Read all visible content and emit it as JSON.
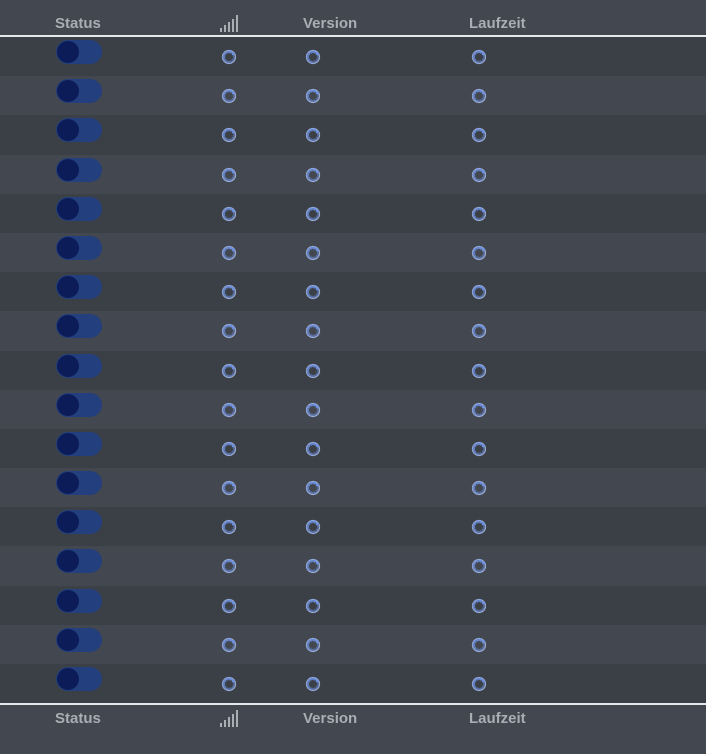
{
  "columns": {
    "status": "Status",
    "signal_icon": "signal-strength-icon",
    "version": "Version",
    "runtime": "Laufzeit"
  },
  "colors": {
    "background": "#43474f",
    "row_alt": "#3b3f46",
    "header_text": "#a9adb4",
    "toggle_track": "#233f7d",
    "toggle_knob": "#0c1c58",
    "spinner": "#5b7fd6"
  },
  "rows": [
    {
      "status_on": false,
      "signal": "loading",
      "version": "loading",
      "runtime": "loading"
    },
    {
      "status_on": false,
      "signal": "loading",
      "version": "loading",
      "runtime": "loading"
    },
    {
      "status_on": false,
      "signal": "loading",
      "version": "loading",
      "runtime": "loading"
    },
    {
      "status_on": false,
      "signal": "loading",
      "version": "loading",
      "runtime": "loading"
    },
    {
      "status_on": false,
      "signal": "loading",
      "version": "loading",
      "runtime": "loading"
    },
    {
      "status_on": false,
      "signal": "loading",
      "version": "loading",
      "runtime": "loading"
    },
    {
      "status_on": false,
      "signal": "loading",
      "version": "loading",
      "runtime": "loading"
    },
    {
      "status_on": false,
      "signal": "loading",
      "version": "loading",
      "runtime": "loading"
    },
    {
      "status_on": false,
      "signal": "loading",
      "version": "loading",
      "runtime": "loading"
    },
    {
      "status_on": false,
      "signal": "loading",
      "version": "loading",
      "runtime": "loading"
    },
    {
      "status_on": false,
      "signal": "loading",
      "version": "loading",
      "runtime": "loading"
    },
    {
      "status_on": false,
      "signal": "loading",
      "version": "loading",
      "runtime": "loading"
    },
    {
      "status_on": false,
      "signal": "loading",
      "version": "loading",
      "runtime": "loading"
    },
    {
      "status_on": false,
      "signal": "loading",
      "version": "loading",
      "runtime": "loading"
    },
    {
      "status_on": false,
      "signal": "loading",
      "version": "loading",
      "runtime": "loading"
    },
    {
      "status_on": false,
      "signal": "loading",
      "version": "loading",
      "runtime": "loading"
    },
    {
      "status_on": false,
      "signal": "loading",
      "version": "loading",
      "runtime": "loading"
    }
  ]
}
